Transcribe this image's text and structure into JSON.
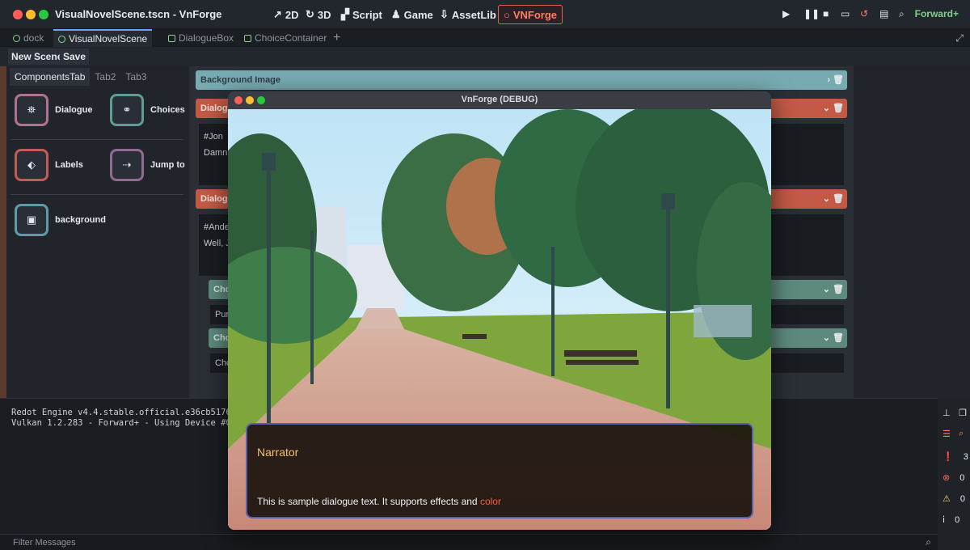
{
  "window": {
    "title": "VisualNovelScene.tscn - VnForge"
  },
  "main_buttons": [
    {
      "label": "2D",
      "icon": "↗"
    },
    {
      "label": "3D",
      "icon": "↻"
    },
    {
      "label": "Script",
      "icon": "▞"
    },
    {
      "label": "Game",
      "icon": "♟"
    },
    {
      "label": "AssetLib",
      "icon": "⇩"
    },
    {
      "label": "VNForge",
      "icon": "○"
    }
  ],
  "renderer": "Forward+",
  "scene_tabs": [
    "dock",
    "VisualNovelScene",
    "DialogueBox",
    "ChoiceContainer"
  ],
  "toolbar": {
    "new_scene": "New Scene",
    "save": "Save"
  },
  "component_tabs": [
    "ComponentsTab",
    "Tab2",
    "Tab3"
  ],
  "components": [
    {
      "label": "Dialogue",
      "icon": "⛯",
      "color": "#b0738f"
    },
    {
      "label": "Choices",
      "icon": "⚭",
      "color": "#5e9c94"
    },
    {
      "label": "Labels",
      "icon": "⬖",
      "color": "#c25a56"
    },
    {
      "label": "Jump to",
      "icon": "⇢",
      "color": "#8f6a8f"
    },
    {
      "label": "background",
      "icon": "▣",
      "color": "#5f9aa8"
    }
  ],
  "scene_rows": {
    "background": "Background Image",
    "dialogue1": "Dialog",
    "dialogue1_text": [
      "#Jon",
      "Damn"
    ],
    "dialogue2": "Dialog",
    "dialogue2_text": [
      "#Ande",
      "Well, J"
    ],
    "choice1": "Cho",
    "choice1_value": "Pur",
    "choice2": "Cho",
    "choice2_value": "Cho"
  },
  "output_log": [
    "Redot Engine v4.4.stable.official.e36cb5176 (2",
    "Vulkan 1.2.283 - Forward+ - Using Device #0: A"
  ],
  "filter_placeholder": "Filter Messages",
  "message_counts": [
    "3",
    "0",
    "0",
    "0"
  ],
  "game_window": {
    "title": "VnForge (DEBUG)",
    "speaker": "Narrator",
    "dialogue_text": "This is sample dialogue text. It supports effects and ",
    "dialogue_highlight": "color"
  }
}
